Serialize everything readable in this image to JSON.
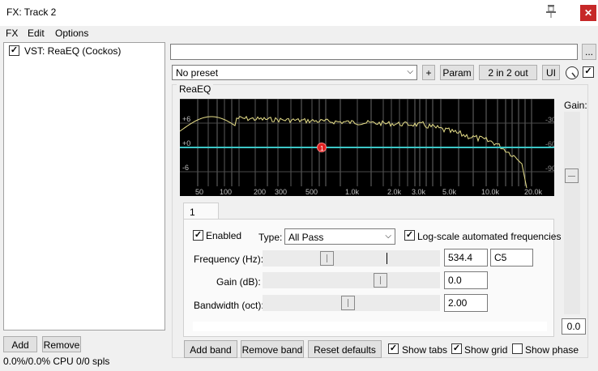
{
  "window": {
    "title": "FX: Track 2"
  },
  "menu": {
    "items": [
      "FX",
      "Edit",
      "Options"
    ]
  },
  "fx_list": {
    "items": [
      {
        "label": "VST: ReaEQ (Cockos)",
        "checked": true
      }
    ],
    "add_label": "Add",
    "remove_label": "Remove",
    "cpu_status": "0.0%/0.0% CPU 0/0 spls"
  },
  "toolbar": {
    "preset_value": "No preset",
    "plus_label": "+",
    "param_label": "Param",
    "io_label": "2 in 2 out",
    "ui_label": "UI",
    "more_label": "..."
  },
  "plugin": {
    "name": "ReaEQ"
  },
  "graph": {
    "db_labels": [
      "+6",
      "+0",
      "-6"
    ],
    "right_labels": [
      "-30",
      "-60",
      "-90"
    ],
    "freq_labels": [
      "50",
      "100",
      "200",
      "300",
      "500",
      "1.0k",
      "2.0k",
      "3.0k",
      "5.0k",
      "10.0k",
      "20.0k"
    ],
    "colors": {
      "curve": "#e8e08a",
      "flat": "#3cc6c6",
      "grid": "#505050",
      "node": "#e02020",
      "background": "#000000"
    }
  },
  "band_tabs": [
    "1"
  ],
  "band": {
    "enabled_label": "Enabled",
    "enabled": true,
    "type_label": "Type:",
    "type_value": "All Pass",
    "log_scale_label": "Log-scale automated frequencies",
    "log_scale": true,
    "frequency_label": "Frequency (Hz):",
    "frequency_value": "534.4",
    "frequency_note": "C5",
    "gain_label": "Gain (dB):",
    "gain_value": "0.0",
    "bandwidth_label": "Bandwidth (oct):",
    "bandwidth_value": "2.00",
    "frequency_level": 0.35,
    "gain_level": 0.68,
    "bandwidth_level": 0.48
  },
  "output_gain": {
    "label": "Gain:",
    "value": "0.0",
    "level": 0.7
  },
  "bottom": {
    "add_band_label": "Add band",
    "remove_band_label": "Remove band",
    "reset_label": "Reset defaults",
    "show_tabs_label": "Show tabs",
    "show_tabs": true,
    "show_grid_label": "Show grid",
    "show_grid": true,
    "show_phase_label": "Show phase",
    "show_phase": false
  }
}
